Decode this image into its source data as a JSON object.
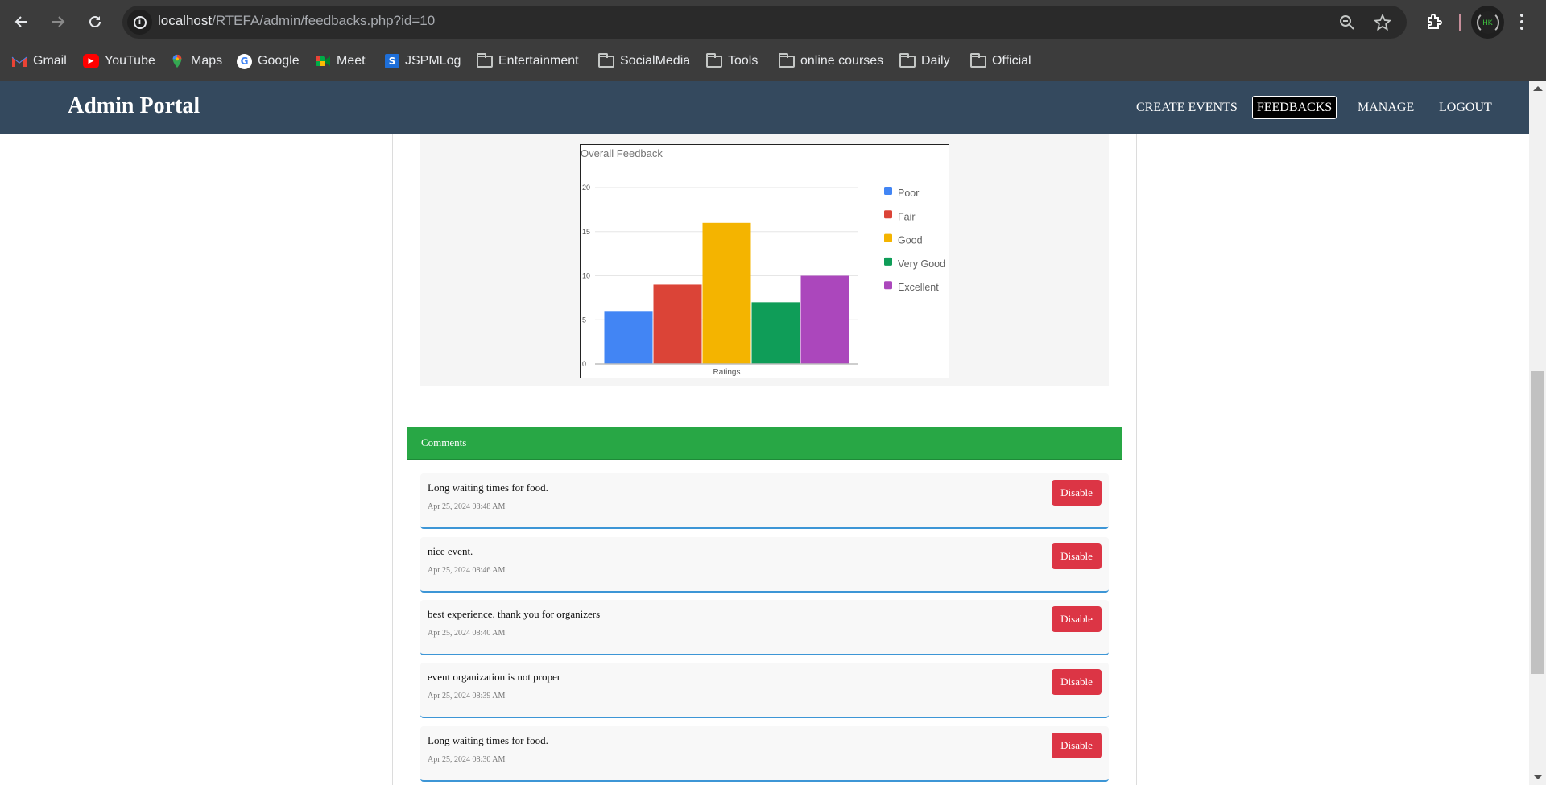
{
  "browser": {
    "url_host": "localhost",
    "url_path": "/RTEFA/admin/feedbacks.php?id=10",
    "avatar_initials": "HK",
    "bookmarks": [
      {
        "label": "Gmail",
        "icon": "gmail-icon"
      },
      {
        "label": "YouTube",
        "icon": "youtube-icon"
      },
      {
        "label": "Maps",
        "icon": "maps-icon"
      },
      {
        "label": "Google",
        "icon": "google-icon"
      },
      {
        "label": "Meet",
        "icon": "meet-icon"
      },
      {
        "label": "JSPMLog",
        "icon": "jspmlog-icon"
      },
      {
        "label": "Entertainment",
        "icon": "folder-icon"
      },
      {
        "label": "SocialMedia",
        "icon": "folder-icon"
      },
      {
        "label": "Tools",
        "icon": "folder-icon"
      },
      {
        "label": "online courses",
        "icon": "folder-icon"
      },
      {
        "label": "Daily",
        "icon": "folder-icon"
      },
      {
        "label": "Official",
        "icon": "folder-icon"
      }
    ]
  },
  "navbar": {
    "brand": "Admin Portal",
    "links": [
      {
        "label": "CREATE EVENTS",
        "active": false
      },
      {
        "label": "FEEDBACKS",
        "active": true
      },
      {
        "label": "MANAGE",
        "active": false
      },
      {
        "label": "LOGOUT",
        "active": false
      }
    ],
    "background": "#34495e"
  },
  "chart_data": {
    "type": "bar",
    "title": "Overall Feedback",
    "xlabel": "Ratings",
    "ylabel": "",
    "categories": [
      "Ratings"
    ],
    "series": [
      {
        "name": "Poor",
        "values": [
          6
        ],
        "color": "#4285f4"
      },
      {
        "name": "Fair",
        "values": [
          9
        ],
        "color": "#db4437"
      },
      {
        "name": "Good",
        "values": [
          16
        ],
        "color": "#f4b400"
      },
      {
        "name": "Very Good",
        "values": [
          7
        ],
        "color": "#0f9d58"
      },
      {
        "name": "Excellent",
        "values": [
          10
        ],
        "color": "#ab47bc"
      }
    ],
    "ylim": [
      0,
      20
    ],
    "yticks": [
      0,
      5,
      10,
      15,
      20
    ],
    "grid": true,
    "legend": "right"
  },
  "comments": {
    "title": "Comments",
    "header_color": "#28a745",
    "disable_label": "Disable",
    "items": [
      {
        "text": "Long waiting times for food.",
        "time": "Apr 25, 2024 08:48 AM"
      },
      {
        "text": "nice event.",
        "time": "Apr 25, 2024 08:46 AM"
      },
      {
        "text": "best experience. thank you for organizers",
        "time": "Apr 25, 2024 08:40 AM"
      },
      {
        "text": "event organization is not proper",
        "time": "Apr 25, 2024 08:39 AM"
      },
      {
        "text": "Long waiting times for food.",
        "time": "Apr 25, 2024 08:30 AM"
      }
    ]
  }
}
